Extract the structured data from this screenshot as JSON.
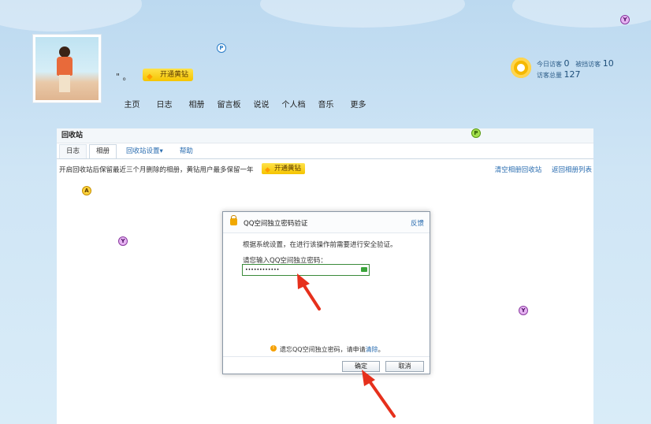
{
  "profile": {
    "nickname": "\" 。",
    "vip_label": "开通黄钻",
    "nav": [
      "主页",
      "日志",
      "相册",
      "留言板",
      "说说",
      "个人档",
      "音乐",
      "更多"
    ]
  },
  "stats": {
    "today_label": "今日访客",
    "today_value": "0",
    "blocked_label": "被挡访客",
    "blocked_value": "10",
    "total_label": "访客总量",
    "total_value": "127"
  },
  "markers": {
    "p": "P",
    "y": "Y",
    "a": "A"
  },
  "recycle": {
    "title": "回收站",
    "tabs": [
      "日志",
      "相册",
      "回收站设置▾",
      "帮助"
    ],
    "active_tab": "相册",
    "notice": "开启回收站后保留最近三个月删除的相册，黄钻用户最多保留一年",
    "notice_badge": "开通黄钻",
    "links": [
      "清空相册回收站",
      "返回相册列表"
    ]
  },
  "dialog": {
    "title": "QQ空间独立密码验证",
    "feedback": "反馈",
    "message": "根据系统设置，在进行该操作前需要进行安全验证。",
    "label": "请您输入QQ空间独立密码：",
    "password_value": "••••••••••••",
    "tip_prefix": "遗忘QQ空间独立密码，请申请",
    "tip_link": "清除",
    "tip_suffix": "。",
    "ok": "确定",
    "cancel": "取消"
  },
  "colors": {
    "accent": "#2a6db0",
    "vip_gold": "#f5c400",
    "arrow": "#e6301c"
  }
}
